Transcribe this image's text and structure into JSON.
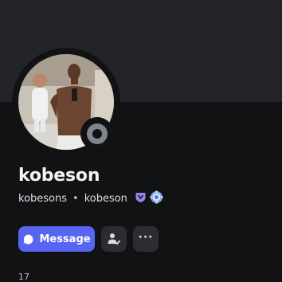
{
  "profile": {
    "display_name": "kobeson",
    "username": "kobesons",
    "separator": "•",
    "secondary_name": "kobeson",
    "avatar_icon": "profile-photo",
    "status": "offline",
    "status_color": "#80848e",
    "badges": [
      {
        "icon": "hypesquad-badge-icon",
        "color": "#9c84ef"
      },
      {
        "icon": "nitro-gem-badge-icon",
        "color": "#a1c5f8"
      }
    ]
  },
  "actions": {
    "message_label": "Message",
    "message_color": "#5865f2",
    "friend_icon": "add-friend-icon",
    "more_icon": "more-icon",
    "more_label": "···"
  },
  "stats": {
    "count": "17"
  }
}
